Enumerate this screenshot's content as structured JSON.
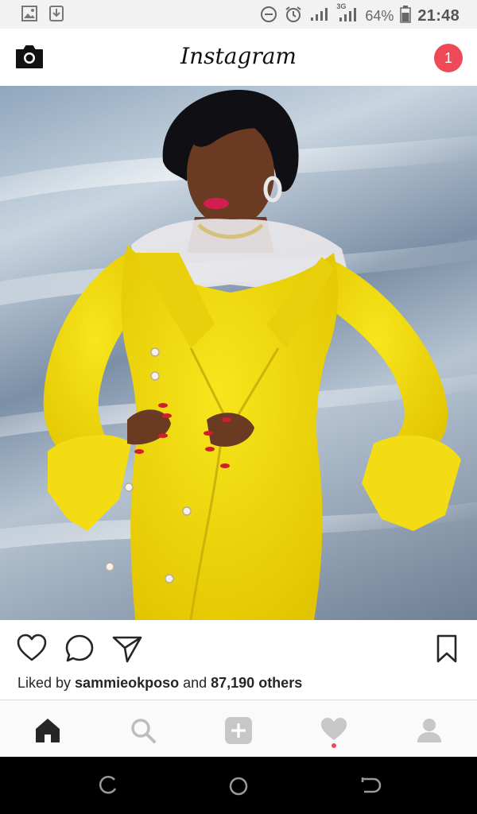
{
  "status_bar": {
    "battery": "64%",
    "time": "21:48",
    "network_3g": "3G"
  },
  "header": {
    "title": "Instagram",
    "notification_count": "1"
  },
  "post": {
    "liked_by_prefix": "Liked by ",
    "liked_by_user": "sammieokposo",
    "liked_by_and": " and ",
    "liked_by_others": "87,190 others"
  },
  "colors": {
    "badge": "#ed4956",
    "dress": "#f2dd12",
    "system_nav": "#000000"
  },
  "icons": {
    "header_left": "camera-icon",
    "actions": [
      "heart-icon",
      "comment-icon",
      "share-icon",
      "bookmark-icon"
    ],
    "nav": [
      "home-icon",
      "search-icon",
      "add-post-icon",
      "activity-heart-icon",
      "profile-icon"
    ],
    "system": [
      "recent-apps-icon",
      "home-circle-icon",
      "back-icon"
    ]
  }
}
